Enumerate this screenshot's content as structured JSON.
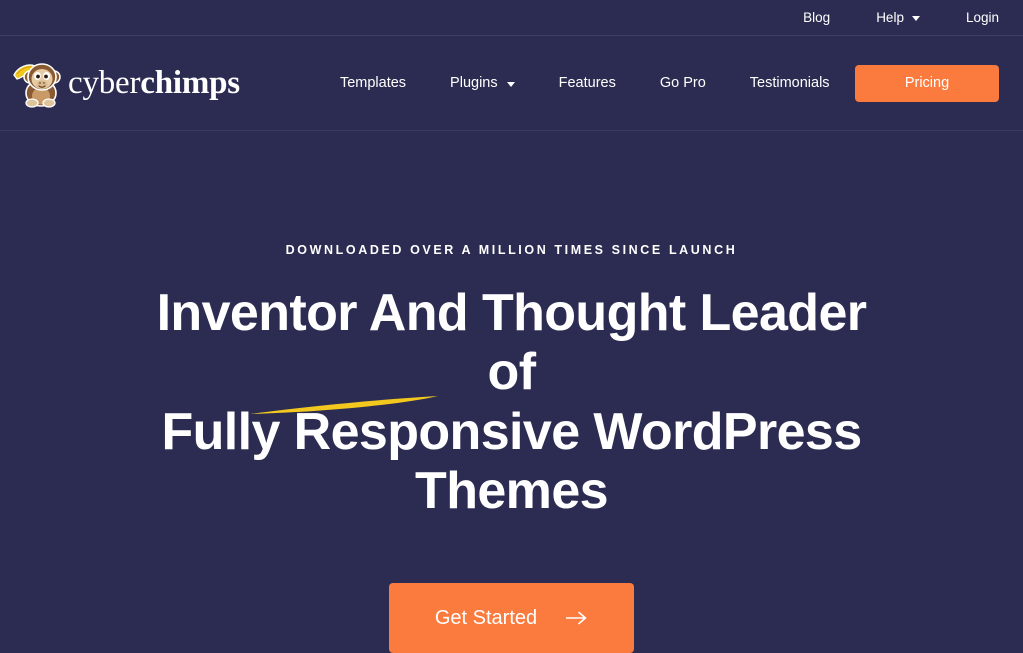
{
  "topbar": {
    "links": [
      {
        "label": "Blog",
        "has_dropdown": false
      },
      {
        "label": "Help",
        "has_dropdown": true
      },
      {
        "label": "Login",
        "has_dropdown": false
      }
    ]
  },
  "header": {
    "brand": {
      "name_light": "cyber",
      "name_bold": "chimps",
      "logo_icon": "monkey-mascot-with-banana-icon"
    },
    "nav": [
      {
        "label": "Templates",
        "has_dropdown": false
      },
      {
        "label": "Plugins",
        "has_dropdown": true
      },
      {
        "label": "Features",
        "has_dropdown": false
      },
      {
        "label": "Go Pro",
        "has_dropdown": false
      },
      {
        "label": "Testimonials",
        "has_dropdown": false
      }
    ],
    "pricing_label": "Pricing"
  },
  "hero": {
    "eyebrow": "Downloaded over a million times since launch",
    "headline_line1": "Inventor And Thought Leader of",
    "headline_line2": "Fully Responsive WordPress",
    "headline_line3": "Themes",
    "cta_label": "Get Started",
    "cta_arrow_icon": "arrow-right-icon"
  },
  "colors": {
    "background": "#2c2c52",
    "accent_orange": "#fb7b3f",
    "swoosh_yellow": "#f2c81e",
    "text": "#ffffff"
  }
}
